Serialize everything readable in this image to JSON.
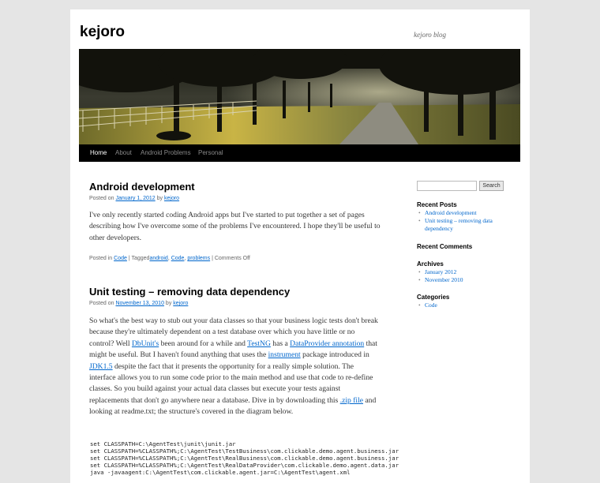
{
  "site": {
    "title": "kejoro",
    "description": "kejoro blog"
  },
  "nav": {
    "items": [
      "Home",
      "About",
      "Android Problems",
      "Personal"
    ]
  },
  "posts": [
    {
      "title": "Android development",
      "meta_prefix": "Posted on",
      "date": "January 1, 2012",
      "by": "by",
      "author": "kejoro",
      "body": "I've only recently started coding Android apps but I've started to put together a set of pages describing how I've overcome some of the problems I've encountered.  I hope they'll be useful to other developers.",
      "footer": {
        "posted_in": "Posted in",
        "category": "Code",
        "sep1": "|",
        "tagged": "Tagged",
        "tags": [
          "android",
          "Code",
          "problems"
        ],
        "sep2": "|",
        "comments": "Comments Off"
      }
    },
    {
      "title": "Unit testing – removing data dependency",
      "meta_prefix": "Posted on",
      "date": "November 13, 2010",
      "by": "by",
      "author": "kejoro",
      "body_parts": {
        "p1": "So what's the best way to stub out your data classes so that your business logic tests don't break because they're ultimately dependent on a test database over which you have little or no control?  Well ",
        "link_dbunit": "DbUnit's",
        "p2": " been around for a while and ",
        "link_testng": "TestNG",
        "p3": " has a ",
        "link_dataprovider": "DataProvider annotation",
        "p4": " that might be useful.  But I haven't found anything that uses the ",
        "link_instrument": "instrument",
        "p5": " package introduced in ",
        "link_jdk": "JDK1.5",
        "p6": " despite the fact that it presents the opportunity for a really simple solution.  The interface allows you to run some code prior to the main method and use that code to re-define classes.  So you build against your actual data classes but execute your tests against replacements that don't go anywhere near a database.  Dive in by downloading this ",
        "link_zip": ".zip file",
        "p7": " and looking at readme.txt; the structure's covered in the diagram below."
      },
      "code_lines": [
        "set CLASSPATH=C:\\AgentTest\\junit\\junit.jar",
        "set CLASSPATH=%CLASSPATH%;C:\\AgentTest\\TestBusiness\\com.clickable.demo.agent.business.jar",
        "set CLASSPATH=%CLASSPATH%;C:\\AgentTest\\RealBusiness\\com.clickable.demo.agent.business.jar",
        "set CLASSPATH=%CLASSPATH%;C:\\AgentTest\\RealDataProvider\\com.clickable.demo.agent.data.jar",
        "java -javaagent:C:\\AgentTest\\com.clickable.agent.jar=C:\\AgentTest\\agent.xml"
      ]
    }
  ],
  "sidebar": {
    "search_button": "Search",
    "search_value": "",
    "recent_posts_title": "Recent Posts",
    "recent_posts": [
      "Android development",
      "Unit testing – removing data dependency"
    ],
    "recent_comments_title": "Recent Comments",
    "archives_title": "Archives",
    "archives": [
      "January 2012",
      "November 2010"
    ],
    "categories_title": "Categories",
    "categories": [
      "Code"
    ]
  },
  "colors": {
    "link": "#0066cc",
    "nav_bg": "#000000",
    "page_bg": "#e5e5e5"
  }
}
